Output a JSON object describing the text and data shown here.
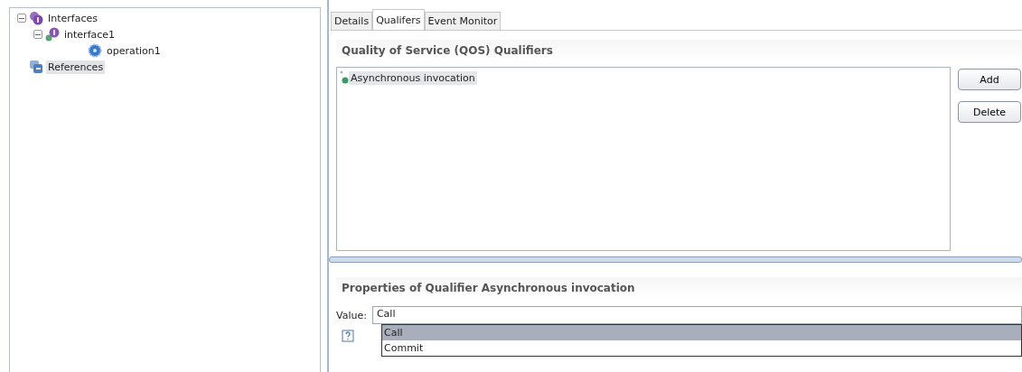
{
  "tree": [
    {
      "label": "Interfaces",
      "kind": "interfaces",
      "expanded": true,
      "selected": false,
      "children": [
        {
          "label": "interface1",
          "kind": "interface",
          "expanded": true,
          "selected": false,
          "children": [
            {
              "label": "operation1",
              "kind": "operation",
              "selected": false
            }
          ]
        }
      ]
    },
    {
      "label": "References",
      "kind": "references",
      "selected": true
    }
  ],
  "tabs": [
    {
      "label": "Details",
      "selected": false
    },
    {
      "label": "Qualifers",
      "selected": true
    },
    {
      "label": "Event Monitor",
      "selected": false
    }
  ],
  "qos": {
    "title": "Quality of Service (QOS) Qualifiers",
    "items": [
      {
        "label": "Asynchronous invocation",
        "selected": true
      }
    ],
    "buttons": [
      "Add",
      "Delete"
    ]
  },
  "properties": {
    "title": "Properties of Qualifier Asynchronous invocation",
    "value_label": "Value:",
    "value": "Call",
    "options": [
      {
        "label": "Call",
        "selected": true
      },
      {
        "label": "Commit",
        "selected": false
      }
    ]
  }
}
